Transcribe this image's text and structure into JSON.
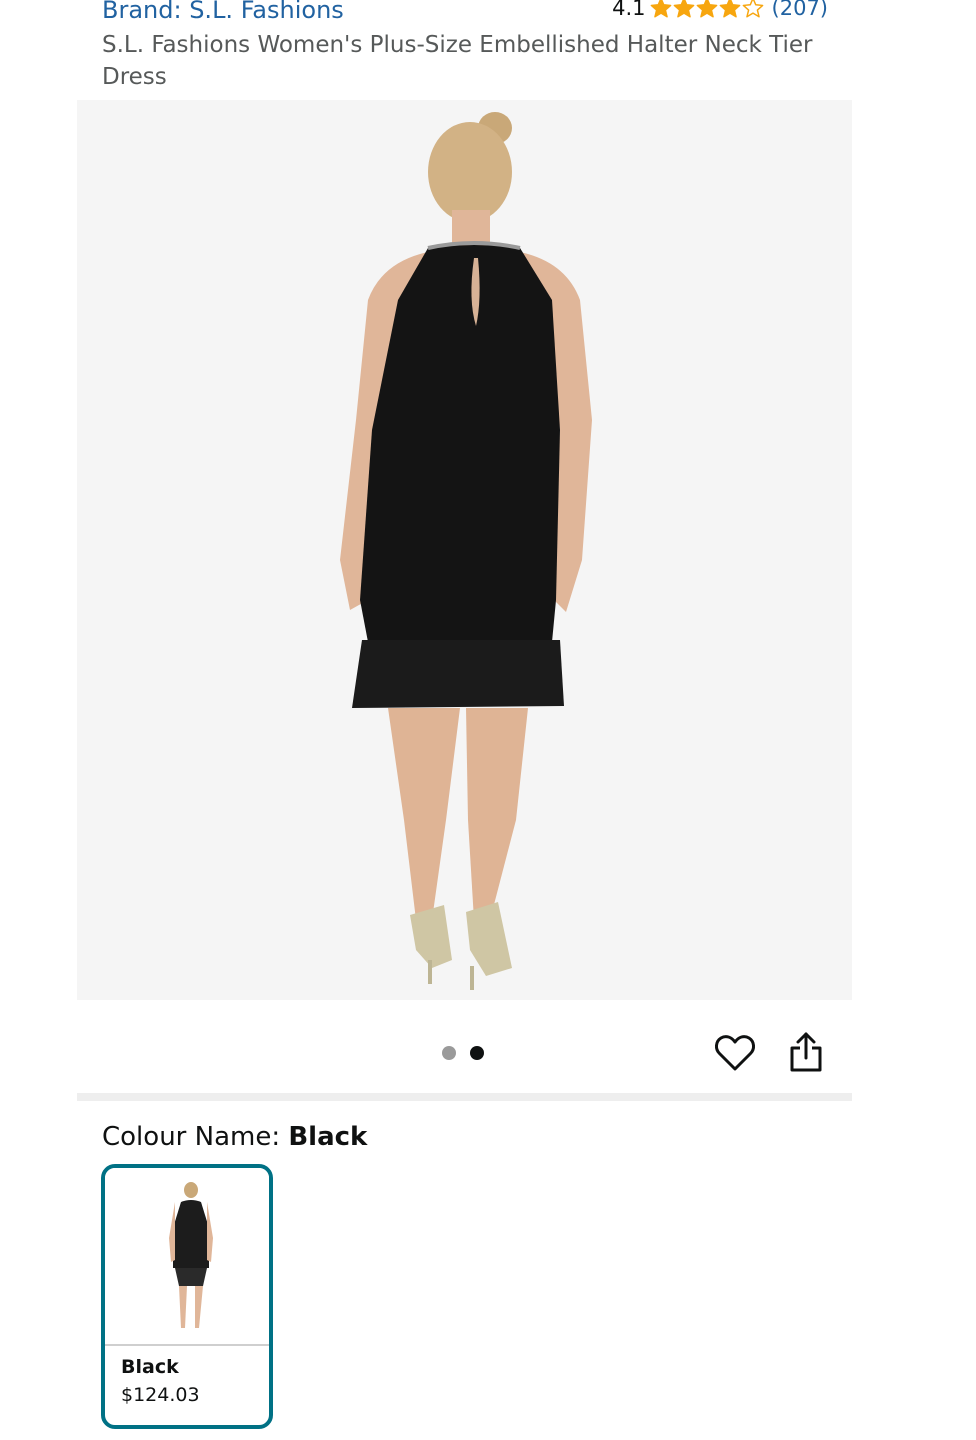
{
  "header": {
    "brand_link": "Brand: S.L. Fashions",
    "rating_value": "4.1",
    "rating_stars": 4.1,
    "rating_count": "(207)",
    "product_title": "S.L. Fashions Women's Plus-Size Embellished Halter Neck Tier Dress"
  },
  "gallery": {
    "dot_count": 2,
    "active_dot": 2
  },
  "actions": {
    "wishlist_icon": "heart-icon",
    "share_icon": "share-icon"
  },
  "colour": {
    "label": "Colour Name: ",
    "value": "Black"
  },
  "swatches": [
    {
      "name": "Black",
      "price": "$124.03"
    }
  ],
  "colors": {
    "link": "#2162a1",
    "star": "#f7a60f",
    "selected_border": "#007185"
  }
}
